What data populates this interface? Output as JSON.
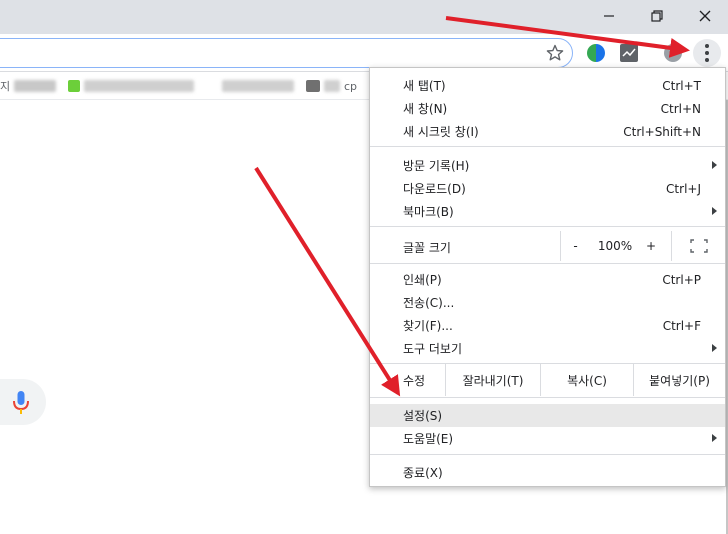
{
  "window": {
    "controls": [
      "minimize-icon",
      "restore-icon",
      "close-icon"
    ]
  },
  "toolbar": {
    "icons": [
      "star-icon",
      "edge-extension-icon",
      "chart-extension-icon",
      "avatar-icon",
      "more-vert-icon"
    ]
  },
  "bookmarks": {
    "first_char": "지",
    "last_text": "cp"
  },
  "menu": {
    "new_tab": {
      "label": "새 탭(T)",
      "shortcut": "Ctrl+T"
    },
    "new_window": {
      "label": "새 창(N)",
      "shortcut": "Ctrl+N"
    },
    "incognito": {
      "label": "새 시크릿 창(I)",
      "shortcut": "Ctrl+Shift+N"
    },
    "history": {
      "label": "방문 기록(H)"
    },
    "downloads": {
      "label": "다운로드(D)",
      "shortcut": "Ctrl+J"
    },
    "bookmarks": {
      "label": "북마크(B)"
    },
    "zoom": {
      "label": "글꼴 크기",
      "minus": "-",
      "value": "100%",
      "plus": "+"
    },
    "print": {
      "label": "인쇄(P)",
      "shortcut": "Ctrl+P"
    },
    "cast": {
      "label": "전송(C)..."
    },
    "find": {
      "label": "찾기(F)...",
      "shortcut": "Ctrl+F"
    },
    "more_tools": {
      "label": "도구 더보기"
    },
    "edit": {
      "label": "수정",
      "cut": "잘라내기(T)",
      "copy": "복사(C)",
      "paste": "붙여넣기(P)"
    },
    "settings": {
      "label": "설정(S)"
    },
    "help": {
      "label": "도움말(E)"
    },
    "exit": {
      "label": "종료(X)"
    }
  },
  "colors": {
    "annotation_arrow": "#e0202a",
    "menu_highlight": "#e8e8e8"
  }
}
